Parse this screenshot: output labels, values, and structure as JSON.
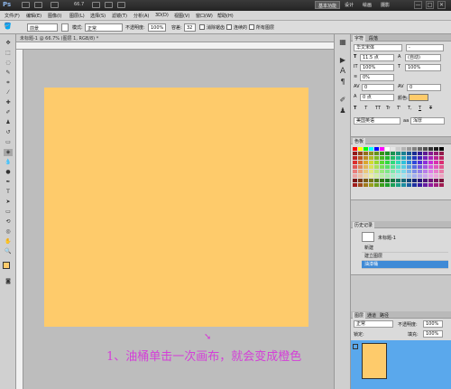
{
  "titlebar": {
    "app_logo": "Ps",
    "zoom": "66.7",
    "workspaces": [
      "基本功能",
      "设计",
      "绘画",
      "摄影"
    ],
    "window_buttons": [
      "—",
      "□",
      "✕"
    ]
  },
  "menu": [
    "文件(F)",
    "编辑(E)",
    "图像(I)",
    "图层(L)",
    "选择(S)",
    "滤镜(T)",
    "分析(A)",
    "3D(D)",
    "视图(V)",
    "窗口(W)",
    "帮助(H)"
  ],
  "options": {
    "fill_source": "前景",
    "mode_label": "模式:",
    "mode_value": "正常",
    "opacity_label": "不透明度:",
    "opacity_value": "100%",
    "tolerance_label": "容差:",
    "tolerance_value": "32",
    "antialias_label": "消除锯齿",
    "contiguous_label": "连续的",
    "all_layers_label": "所有图层"
  },
  "document": {
    "tab_title": "未标题-1 @ 66.7% (图层 1, RGB/8) *"
  },
  "caption": "1、油桶单击一次画布，就会变成橙色",
  "character_panel": {
    "tabs": [
      "字符",
      "段落"
    ],
    "font_family": "华文宋体",
    "font_style": "-",
    "font_size": "11.5 点",
    "leading": "(自动)",
    "vertical_scale": "100%",
    "horizontal_scale": "100%",
    "tracking_pct": "0%",
    "kerning": "0",
    "tracking": "0",
    "baseline_shift": "0 点",
    "color_label": "颜色:",
    "language": "美国英语",
    "antialias": "浑厚",
    "style_buttons": [
      "T",
      "T",
      "TT",
      "Tr",
      "T'",
      "T,",
      "T",
      "T"
    ]
  },
  "swatches_panel": {
    "tabs": [
      "色板"
    ],
    "colors": [
      "#ff0000",
      "#ffff00",
      "#00ff00",
      "#00ffff",
      "#0000ff",
      "#ff00ff",
      "#ffffff",
      "#e6e6e6",
      "#cccccc",
      "#b3b3b3",
      "#999999",
      "#808080",
      "#666666",
      "#4d4d4d",
      "#333333",
      "#1a1a1a",
      "#000000"
    ]
  },
  "history_panel": {
    "tabs": [
      "历史记录"
    ],
    "snapshot": "未标题-1",
    "items": [
      "新建",
      "建立图层",
      "油漆桶"
    ]
  },
  "layers_panel": {
    "tabs": [
      "图层",
      "通道",
      "路径"
    ],
    "blend_mode": "正常",
    "opacity_label": "不透明度:",
    "opacity_value": "100%",
    "lock_label": "锁定:",
    "fill_label": "填充:",
    "fill_value": "100%"
  },
  "colors": {
    "canvas": "#fecb6b",
    "caption": "#d43fd8",
    "selection": "#3f8ad6",
    "foreground": "#fecb6b",
    "background": "#3d9ae4"
  }
}
